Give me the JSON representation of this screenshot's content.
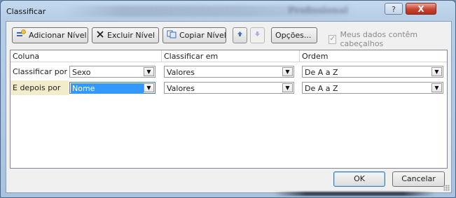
{
  "window": {
    "title": "Classificar",
    "blurred_title_text": "Profissional"
  },
  "titlebar": {
    "help_label": "?",
    "close_label": "X"
  },
  "toolbar": {
    "add_level_label": "Adicionar Nível",
    "delete_level_label": "Excluir Nível",
    "copy_level_label": "Copiar Nível",
    "move_up_icon": "arrow-up-icon",
    "move_down_icon": "arrow-down-icon",
    "options_label": "Opções...",
    "headers_checkbox_label": "Meus dados contêm cabeçalhos",
    "headers_checkbox_checked": true
  },
  "table": {
    "columns": [
      "Coluna",
      "Classificar em",
      "Ordem"
    ],
    "rows": [
      {
        "label": "Classificar por",
        "column": "Sexo",
        "sort_on": "Valores",
        "order": "De A a Z",
        "selected": false
      },
      {
        "label": "E depois por",
        "column": "Nome",
        "sort_on": "Valores",
        "order": "De A a Z",
        "selected": true
      }
    ]
  },
  "footer": {
    "ok_label": "OK",
    "cancel_label": "Cancelar"
  },
  "colors": {
    "selection": "#3399ff",
    "selected_row": "#f2eccd",
    "close_button": "#c8442f"
  }
}
